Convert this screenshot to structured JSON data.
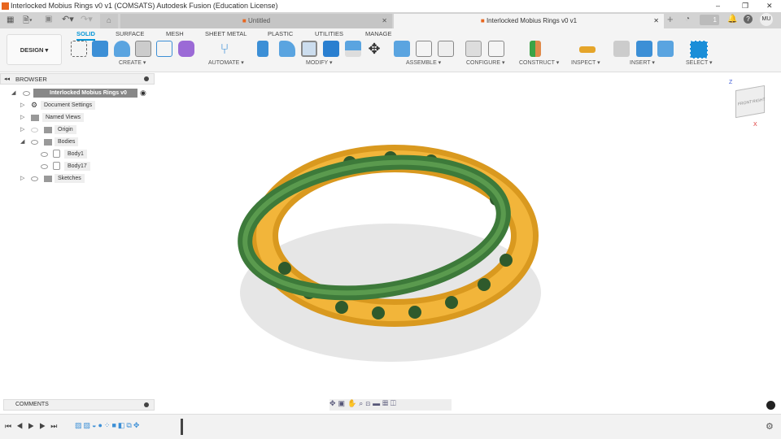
{
  "window": {
    "title": "Interlocked Mobius Rings v0 v1 (COMSATS)   Autodesk Fusion (Education License)",
    "min": "–",
    "max": "❐",
    "close": "✕"
  },
  "tabs": [
    {
      "label": "Untitled"
    },
    {
      "label": "Interlocked Mobius Rings v0 v1"
    }
  ],
  "user": {
    "initials": "MU",
    "jobs": "1"
  },
  "toolbar": {
    "workspace": "DESIGN ▾",
    "tabs": [
      "SOLID",
      "SURFACE",
      "MESH",
      "SHEET METAL",
      "PLASTIC",
      "UTILITIES",
      "MANAGE"
    ],
    "groups": [
      "CREATE ▾",
      "AUTOMATE ▾",
      "MODIFY ▾",
      "ASSEMBLE ▾",
      "CONFIGURE ▾",
      "CONSTRUCT ▾",
      "INSPECT ▾",
      "INSERT ▾",
      "SELECT ▾"
    ]
  },
  "browser": {
    "title": "BROWSER",
    "root": "Interlocked Mobius Rings v0 v1",
    "items": [
      "Document Settings",
      "Named Views",
      "Origin",
      "Bodies",
      "Body1",
      "Body17",
      "Sketches"
    ]
  },
  "comments": {
    "title": "COMMENTS"
  },
  "viewcube": {
    "front": "FRONT",
    "right": "RIGHT",
    "z": "Z",
    "x": "X"
  },
  "colors": {
    "accent": "#0696d7",
    "gold": "#e5a52a",
    "green": "#3d7a3a"
  }
}
